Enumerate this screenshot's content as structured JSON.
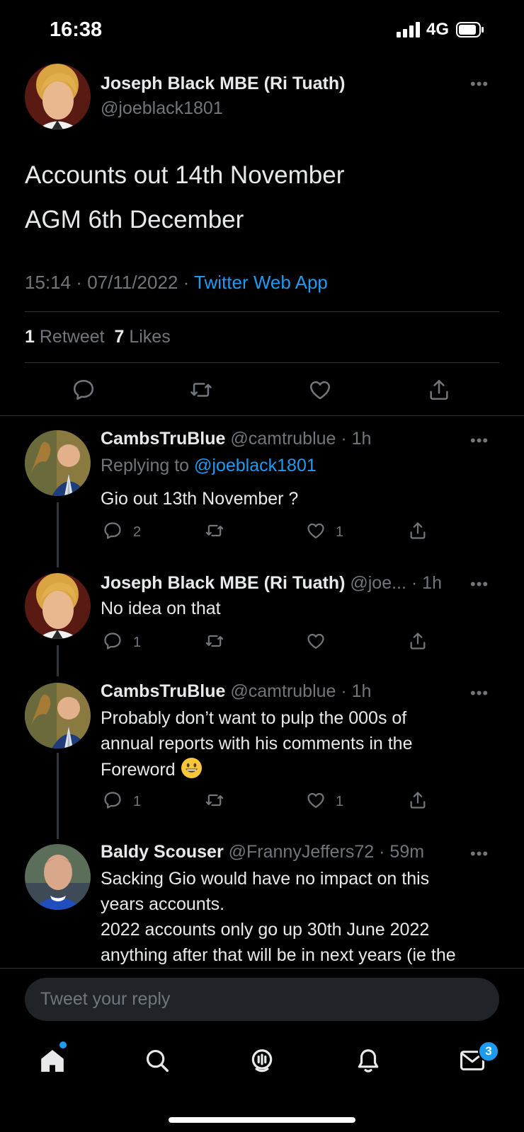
{
  "status_bar": {
    "time": "16:38",
    "network": "4G"
  },
  "main_tweet": {
    "name": "Joseph Black MBE (Ri Tuath)",
    "handle": "@joeblack1801",
    "line1": "Accounts out 14th November",
    "line2": "AGM 6th December",
    "time": "15:14",
    "date": "07/11/2022",
    "source": "Twitter Web App",
    "retweet_count": "1",
    "retweet_label": "Retweet",
    "like_count": "7",
    "like_label": "Likes"
  },
  "replies": [
    {
      "name": "CambsTruBlue",
      "meta": "@camtrublue · 1h",
      "replying_prefix": "Replying to",
      "replying_handle": "@joeblack1801",
      "text": "Gio out 13th November ?",
      "reply_count": "2",
      "retweet_count": "",
      "like_count": "1"
    },
    {
      "name": "Joseph Black MBE (Ri Tuath)",
      "meta": "@joe... · 1h",
      "text": "No idea on that",
      "reply_count": "1",
      "retweet_count": "",
      "like_count": ""
    },
    {
      "name": "CambsTruBlue",
      "meta": "@camtrublue · 1h",
      "text_line1": "Probably don’t want to pulp the 000s of",
      "text_line2": "annual reports with his comments in the",
      "text_line3": "Foreword",
      "emoji": "😄",
      "reply_count": "1",
      "retweet_count": "",
      "like_count": "1"
    },
    {
      "name": "Baldy Scouser",
      "meta": "@FrannyJeffers72 · 59m",
      "text_line1": "Sacking Gio would have no impact on this",
      "text_line2": "years accounts.",
      "text_line3": "2022 accounts only go up 30th June 2022",
      "text_line4": "anything after that will be in next years (ie the"
    }
  ],
  "composer": {
    "placeholder": "Tweet your reply"
  },
  "tab_bar": {
    "messages_badge": "3"
  },
  "colors": {
    "accent": "#1d9bf0",
    "background": "#000000",
    "text": "#e7e9ea",
    "secondary": "#71767b"
  }
}
